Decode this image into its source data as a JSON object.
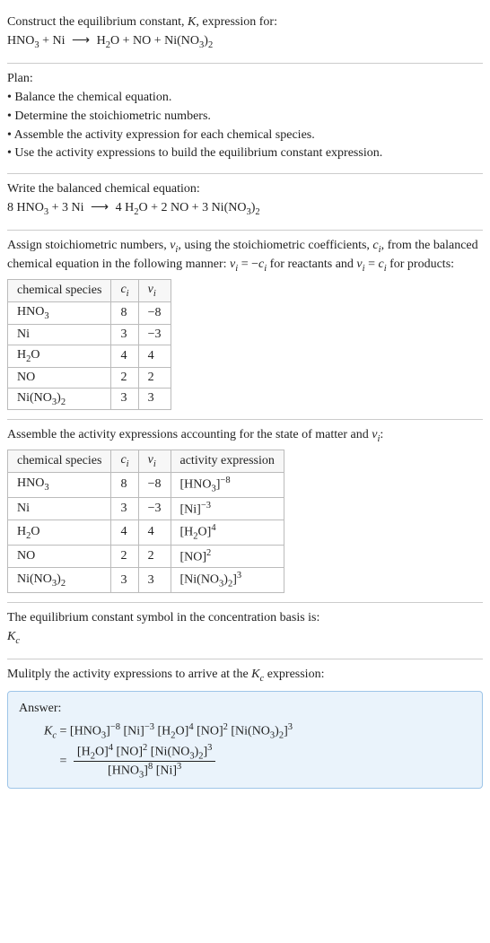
{
  "intro": {
    "line1_pre": "Construct the equilibrium constant, ",
    "line1_post": ", expression for:",
    "reaction_lhs_1": "HNO",
    "reaction_lhs_1_sub": "3",
    "plus": " + ",
    "reaction_lhs_2": "Ni",
    "arrow": "⟶",
    "reaction_rhs_1": "H",
    "reaction_rhs_1_sub": "2",
    "reaction_rhs_1b": "O",
    "reaction_rhs_2": "NO",
    "reaction_rhs_3": "Ni(NO",
    "reaction_rhs_3_sub": "3",
    "reaction_rhs_3b": ")",
    "reaction_rhs_3_sub2": "2",
    "K": "K"
  },
  "plan": {
    "heading": "Plan:",
    "b1": "• Balance the chemical equation.",
    "b2": "• Determine the stoichiometric numbers.",
    "b3": "• Assemble the activity expression for each chemical species.",
    "b4": "• Use the activity expressions to build the equilibrium constant expression."
  },
  "balanced": {
    "heading": "Write the balanced chemical equation:",
    "c1": "8 HNO",
    "c2": " + 3 Ni ",
    "c3": " 4 H",
    "c4": "O + 2 NO + 3 Ni(NO",
    "c5": ")"
  },
  "assign": {
    "text_a": "Assign stoichiometric numbers, ",
    "text_b": ", using the stoichiometric coefficients, ",
    "text_c": ", from the balanced chemical equation in the following manner: ",
    "text_d": " for reactants and ",
    "text_e": " for products:",
    "nu": "ν",
    "c": "c",
    "i": "i",
    "eq1": " = −",
    "eq2": " = "
  },
  "table1": {
    "h1": "chemical species",
    "h2_sym": "c",
    "h2_sub": "i",
    "h3_sym": "ν",
    "h3_sub": "i",
    "rows": [
      {
        "sp_a": "HNO",
        "sp_sub": "3",
        "sp_b": "",
        "c": "8",
        "nu": "−8"
      },
      {
        "sp_a": "Ni",
        "sp_sub": "",
        "sp_b": "",
        "c": "3",
        "nu": "−3"
      },
      {
        "sp_a": "H",
        "sp_sub": "2",
        "sp_b": "O",
        "c": "4",
        "nu": "4"
      },
      {
        "sp_a": "NO",
        "sp_sub": "",
        "sp_b": "",
        "c": "2",
        "nu": "2"
      },
      {
        "sp_a": "Ni(NO",
        "sp_sub": "3",
        "sp_b": ")",
        "sp_sub2": "2",
        "c": "3",
        "nu": "3"
      }
    ]
  },
  "assemble": {
    "text_a": "Assemble the activity expressions accounting for the state of matter and ",
    "text_b": ":"
  },
  "table2": {
    "h1": "chemical species",
    "h4": "activity expression",
    "rows": [
      {
        "sp_a": "HNO",
        "sp_sub": "3",
        "sp_b": "",
        "c": "8",
        "nu": "−8",
        "act_a": "[HNO",
        "act_sub": "3",
        "act_b": "]",
        "act_sup": "−8"
      },
      {
        "sp_a": "Ni",
        "sp_sub": "",
        "sp_b": "",
        "c": "3",
        "nu": "−3",
        "act_a": "[Ni]",
        "act_sub": "",
        "act_b": "",
        "act_sup": "−3"
      },
      {
        "sp_a": "H",
        "sp_sub": "2",
        "sp_b": "O",
        "c": "4",
        "nu": "4",
        "act_a": "[H",
        "act_sub": "2",
        "act_b": "O]",
        "act_sup": "4"
      },
      {
        "sp_a": "NO",
        "sp_sub": "",
        "sp_b": "",
        "c": "2",
        "nu": "2",
        "act_a": "[NO]",
        "act_sub": "",
        "act_b": "",
        "act_sup": "2"
      },
      {
        "sp_a": "Ni(NO",
        "sp_sub": "3",
        "sp_b": ")",
        "sp_sub2": "2",
        "c": "3",
        "nu": "3",
        "act_a": "[Ni(NO",
        "act_sub": "3",
        "act_b": ")",
        "act_sub2": "2",
        "act_c": "]",
        "act_sup": "3"
      }
    ]
  },
  "symboltext": {
    "line": "The equilibrium constant symbol in the concentration basis is:",
    "Kc_K": "K",
    "Kc_c": "c"
  },
  "multiply": {
    "text_a": "Mulitply the activity expressions to arrive at the ",
    "text_b": " expression:"
  },
  "answer": {
    "label": "Answer:",
    "eq": " = ",
    "terms": {
      "t1a": "[HNO",
      "t1sub": "3",
      "t1b": "]",
      "t1sup": "−8",
      "t2a": " [Ni]",
      "t2sup": "−3",
      "t3a": " [H",
      "t3sub": "2",
      "t3b": "O]",
      "t3sup": "4",
      "t4a": " [NO]",
      "t4sup": "2",
      "t5a": " [Ni(NO",
      "t5sub": "3",
      "t5b": ")",
      "t5sub2": "2",
      "t5c": "]",
      "t5sup": "3"
    },
    "num": {
      "n1a": "[H",
      "n1sub": "2",
      "n1b": "O]",
      "n1sup": "4",
      "n2a": " [NO]",
      "n2sup": "2",
      "n3a": " [Ni(NO",
      "n3sub": "3",
      "n3b": ")",
      "n3sub2": "2",
      "n3c": "]",
      "n3sup": "3"
    },
    "den": {
      "d1a": "[HNO",
      "d1sub": "3",
      "d1b": "]",
      "d1sup": "8",
      "d2a": " [Ni]",
      "d2sup": "3"
    }
  },
  "chart_data": {
    "type": "table",
    "title": "Stoichiometric numbers and activity expressions",
    "species": [
      "HNO3",
      "Ni",
      "H2O",
      "NO",
      "Ni(NO3)2"
    ],
    "c_i": [
      8,
      3,
      4,
      2,
      3
    ],
    "nu_i": [
      -8,
      -3,
      4,
      2,
      3
    ],
    "activity_expression": [
      "[HNO3]^-8",
      "[Ni]^-3",
      "[H2O]^4",
      "[NO]^2",
      "[Ni(NO3)2]^3"
    ]
  }
}
